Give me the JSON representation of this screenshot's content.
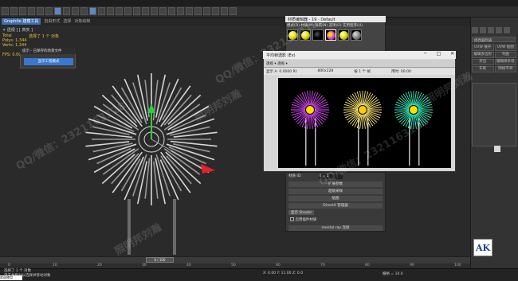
{
  "ribbon": {
    "tabs": [
      "Graphite 建模工具",
      "自由形式",
      "选择",
      "对象绘制"
    ],
    "active_index": 0
  },
  "viewport": {
    "label": "+ 透视 ] [ 真实 ]",
    "stats_labels": "Total\nPolys: 1,344\nVerts: 1,344",
    "fps_label": "FPS:",
    "fps_value": "0.000",
    "selected_label": "选择了 1 个 对象"
  },
  "left_dialog": {
    "title": "提示 - 已保存的场景文件",
    "button": "显示工程模式"
  },
  "material_editor": {
    "title": "材质编辑器 - 19 - Default",
    "menu": "模式(D)  材质(M)  导航(N)  选项(O)  实用程序(U)",
    "slots": [
      {
        "color": "#e4e000",
        "icon": "sphere-yellow-icon"
      },
      {
        "color": "#e4e000",
        "icon": "sphere-yellow-icon"
      },
      {
        "color": "#000000",
        "icon": "sphere-black-icon"
      },
      {
        "color": "#ff40c0",
        "icon": "sphere-pink-icon"
      },
      {
        "color": "#e4e000",
        "icon": "sphere-yellow-icon"
      },
      {
        "color": "#8a8a8a",
        "icon": "sphere-grey-icon"
      }
    ]
  },
  "frame_buffer": {
    "title": "平均帧透影 (Ex)",
    "window_controls": "─ □ ✕",
    "toolbar": "透视  ▾   透视  ▾",
    "status": [
      "显示 A: 0.0000 Rt",
      "800x228",
      "按 1 个 帧",
      "用时: 00:00"
    ]
  },
  "rollout": {
    "label_top": "材质 ID:",
    "value_top": "4 = 1",
    "rows": [
      "扩展参数",
      "超级采样",
      "贴图",
      "DirectX 管理器",
      "mental ray 连接"
    ],
    "check_label": "启用插件材质",
    "shader_button": "显示 Shader"
  },
  "timeline": {
    "slider": "0 / 100",
    "ticks": [
      "0",
      "10",
      "20",
      "30",
      "40",
      "50",
      "60",
      "70",
      "80",
      "90",
      "100"
    ]
  },
  "status": {
    "line1": "选择了 1 个 对象",
    "line2": "单击并拖动以选择并移动对象",
    "welcome": "欢迎使用 MAXScript",
    "coords": "X: 4.00   Y: 11.00   Z: 0.0",
    "grid": "栅格 = 10.0"
  },
  "command_panel": {
    "list_items": [
      "UVW 展开",
      "UVW 贴图",
      "编辑多边形",
      "弯曲",
      "挤出",
      "编辑样条线",
      "车削",
      "网格平滑"
    ],
    "modifier_list": "修改器列表"
  },
  "logo": {
    "text": "AK"
  },
  "watermarks": [
    "QQ/微信：2321163128",
    "照明邦刘瀚",
    "QQ/微信：2321163128",
    "照明邦刘瀚",
    "QQ/微信：2321163128",
    "照明邦刘瀚"
  ],
  "colors": {
    "accent": "#3a78d0",
    "viewport_bg": "#2a2a2a",
    "gizmo_y": "#2ecc40",
    "gizmo_x": "#e8202a"
  }
}
